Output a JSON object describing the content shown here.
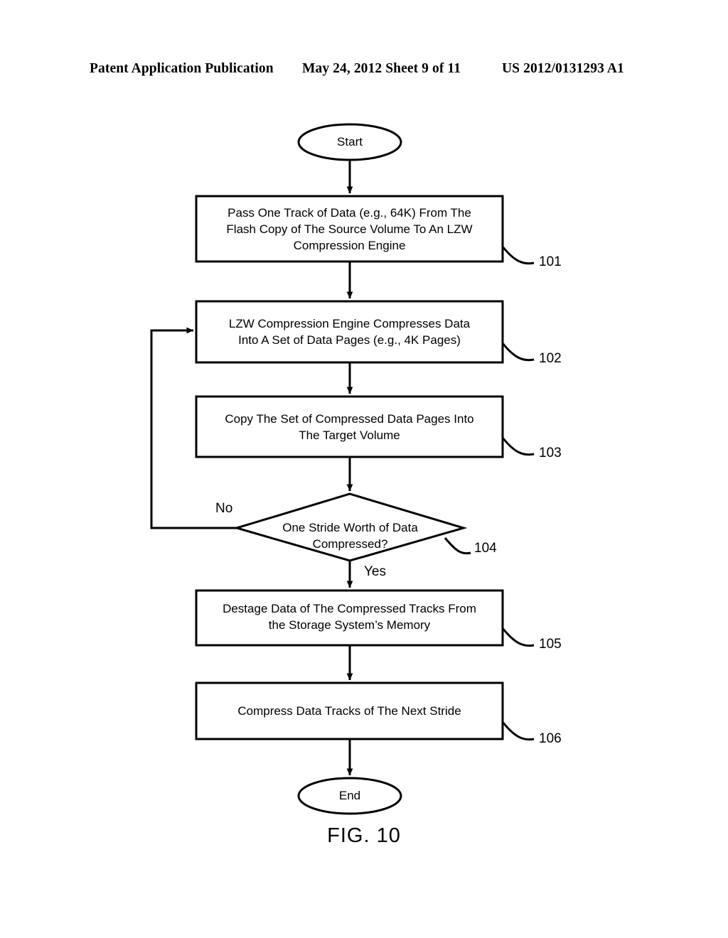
{
  "header": {
    "left": "Patent Application Publication",
    "middle": "May 24, 2012  Sheet 9 of 11",
    "right": "US 2012/0131293 A1"
  },
  "figure": {
    "caption": "FIG. 10",
    "line_color": "#000000",
    "fill_color": "#ffffff"
  },
  "flowchart": {
    "start": {
      "label": "Start"
    },
    "end": {
      "label": "End"
    },
    "steps": [
      {
        "ref": "101",
        "text": "Pass One Track of Data (e.g., 64K) From The\nFlash Copy of The Source Volume To An LZW\nCompression Engine"
      },
      {
        "ref": "102",
        "text": "LZW Compression Engine Compresses Data\nInto A Set of Data Pages (e.g., 4K Pages)"
      },
      {
        "ref": "103",
        "text": "Copy The Set of Compressed Data Pages Into\nThe Target Volume"
      },
      {
        "ref": "105",
        "text": "Destage Data of The Compressed Tracks From\nthe Storage System’s Memory"
      },
      {
        "ref": "106",
        "text": "Compress Data Tracks of The Next Stride"
      }
    ],
    "decision": {
      "ref": "104",
      "text": "One Stride Worth of Data\nCompressed?",
      "no_label": "No",
      "yes_label": "Yes"
    }
  }
}
